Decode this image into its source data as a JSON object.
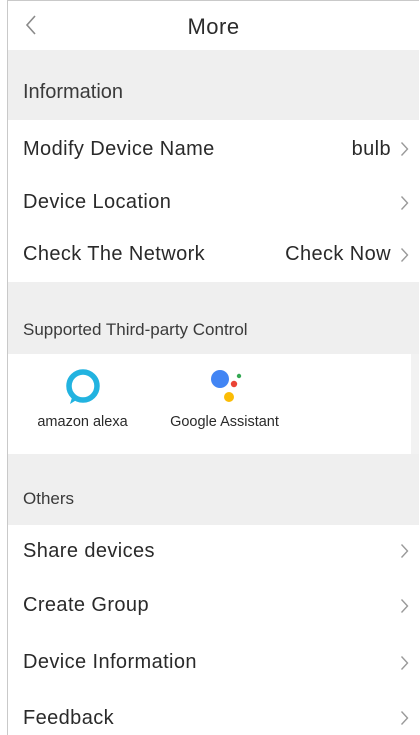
{
  "header": {
    "title": "More"
  },
  "sections": {
    "information": {
      "label": "Information",
      "rows": [
        {
          "label": "Modify Device Name",
          "value": "bulb"
        },
        {
          "label": "Device Location",
          "value": ""
        },
        {
          "label": "Check The Network",
          "value": "Check Now"
        }
      ]
    },
    "third_party": {
      "label": "Supported Third-party Control",
      "services": [
        {
          "name": "amazon alexa",
          "icon": "alexa-logo-icon"
        },
        {
          "name": "Google Assistant",
          "icon": "google-assistant-logo-icon"
        }
      ]
    },
    "others": {
      "label": "Others",
      "rows": [
        {
          "label": "Share devices"
        },
        {
          "label": "Create Group"
        },
        {
          "label": "Device Information"
        },
        {
          "label": "Feedback"
        }
      ]
    }
  },
  "colors": {
    "section_bg": "#efefef",
    "alexa_blue": "#22b3e0",
    "google_blue": "#4285f4",
    "google_red": "#ea4335",
    "google_yellow": "#fbbc05",
    "google_green": "#34a853",
    "chevron": "#9a9a9a"
  }
}
